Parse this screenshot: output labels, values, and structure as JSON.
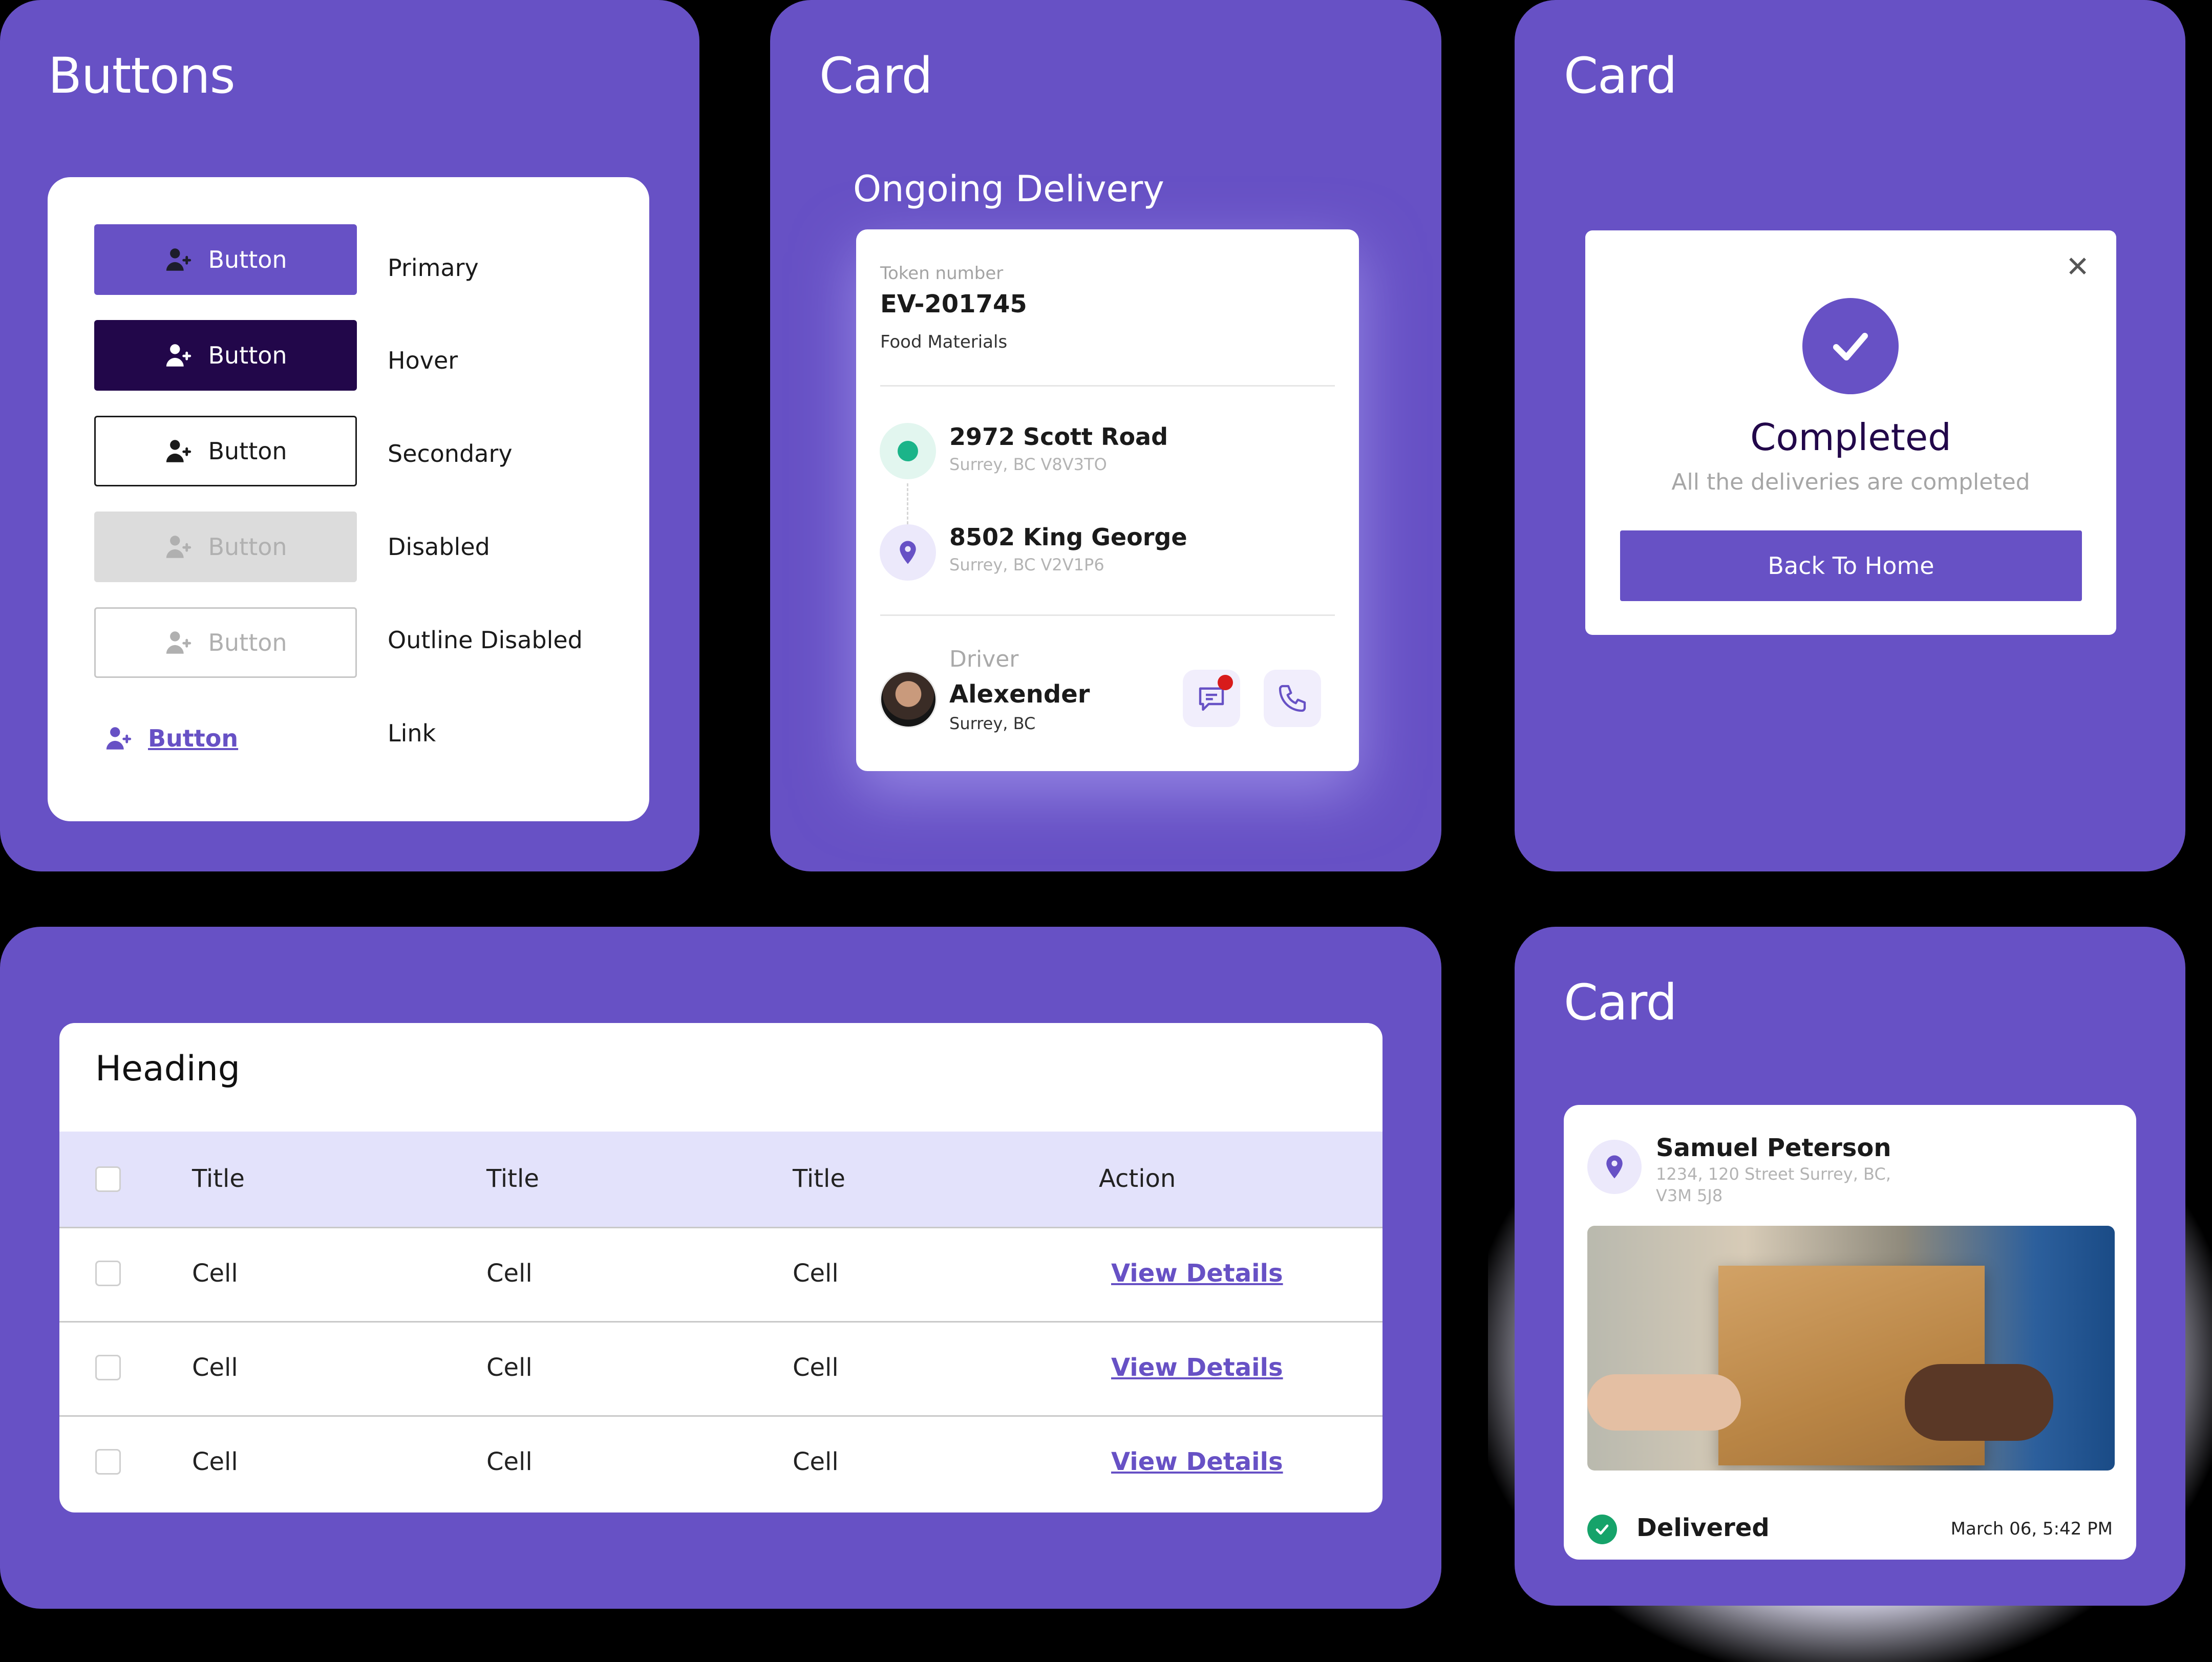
{
  "colors": {
    "primary": "#6751c5",
    "hover": "#22074a",
    "disabled_bg": "#dcdcdc",
    "success": "#16a36a",
    "table_header": "#e3e2fb",
    "notification": "#d81b1b"
  },
  "buttons_panel": {
    "title": "Buttons",
    "button_label": "Button",
    "icon": "user-plus-icon",
    "states": [
      "Primary",
      "Hover",
      "Secondary",
      "Disabled",
      "Outline Disabled",
      "Link"
    ]
  },
  "delivery_panel": {
    "title": "Card",
    "section_title": "Ongoing Delivery",
    "token_label": "Token number",
    "token": "EV-201745",
    "category": "Food Materials",
    "from": {
      "address": "2972 Scott Road",
      "sub": "Surrey, BC V8V3TO"
    },
    "to": {
      "address": "8502 King George",
      "sub": "Surrey, BC V2V1P6",
      "icon": "map-pin-icon"
    },
    "driver": {
      "label": "Driver",
      "name": "Alexender",
      "location": "Surrey, BC"
    },
    "actions": {
      "message_icon": "chat-icon",
      "call_icon": "phone-icon"
    }
  },
  "completed_panel": {
    "title": "Card",
    "status": "Completed",
    "message": "All the deliveries are completed",
    "button": "Back To Home",
    "close_icon": "close-icon",
    "check_icon": "check-icon"
  },
  "table_panel": {
    "heading": "Heading",
    "columns": [
      "Title",
      "Title",
      "Title",
      "Action"
    ],
    "rows": [
      [
        "Cell",
        "Cell",
        "Cell",
        "View Details"
      ],
      [
        "Cell",
        "Cell",
        "Cell",
        "View Details"
      ],
      [
        "Cell",
        "Cell",
        "Cell",
        "View Details"
      ]
    ]
  },
  "delivered_panel": {
    "title": "Card",
    "name": "Samuel Peterson",
    "address_line1": "1234, 120 Street Surrey, BC,",
    "address_line2": "V3M 5J8",
    "status": "Delivered",
    "timestamp": "March 06, 5:42 PM",
    "status_icon": "check-circle-icon"
  }
}
